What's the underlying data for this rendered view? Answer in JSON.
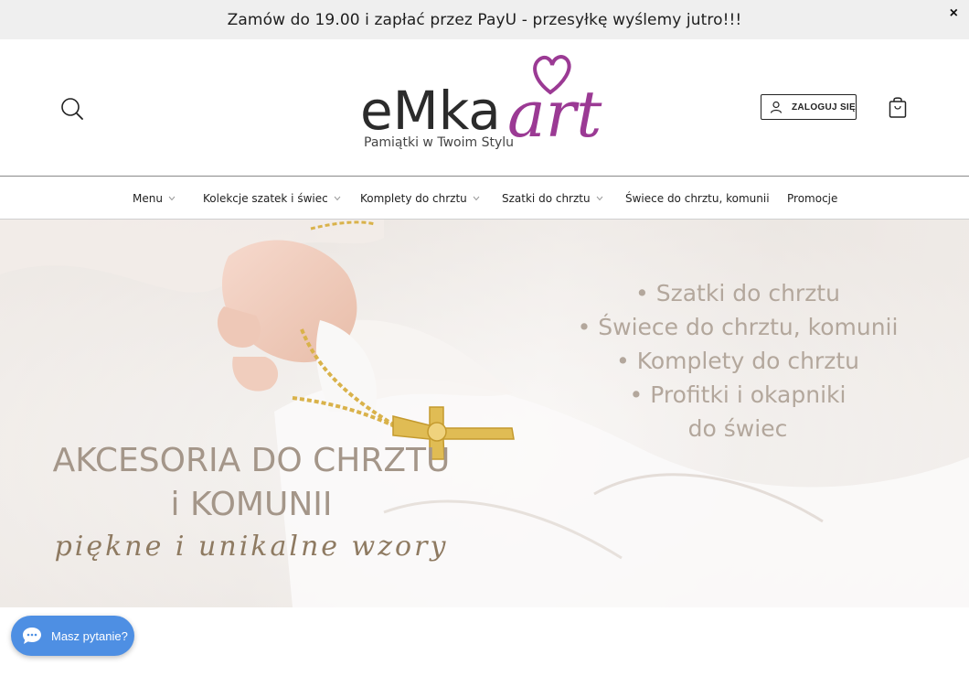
{
  "announcement": {
    "text": "Zamów do 19.00 i zapłać przez PayU - przesyłkę wyślemy jutro!!!",
    "close": "×"
  },
  "header": {
    "logo": {
      "brand_part1": "eMka",
      "brand_part2": "art",
      "tagline": "Pamiątki w Twoim Stylu",
      "colors": {
        "dark": "#2b2b2b",
        "accent": "#9b3a94"
      }
    },
    "login_label": "ZALOGUJ SIĘ",
    "icons": [
      "search-icon",
      "user-icon",
      "shopping-bag-icon"
    ]
  },
  "nav": {
    "items": [
      {
        "label": "Menu",
        "has_dropdown": true
      },
      {
        "label": "Kolekcje szatek i świec",
        "has_dropdown": true
      },
      {
        "label": "Komplety do chrztu",
        "has_dropdown": true
      },
      {
        "label": "Szatki do chrztu",
        "has_dropdown": true
      },
      {
        "label": "Świece do chrztu, komunii",
        "has_dropdown": false
      },
      {
        "label": "Promocje",
        "has_dropdown": false
      }
    ]
  },
  "hero": {
    "list": [
      "• Szatki do chrztu",
      "• Świece do chrztu, komunii",
      "• Komplety do chrztu",
      "• Profitki i okapniki",
      "do świec"
    ],
    "title_line1": "AKCESORIA DO CHRZTU",
    "title_line2": "i KOMUNII",
    "script": "piękne i unikalne wzory"
  },
  "chat": {
    "label": "Masz pytanie?",
    "color": "#4e8fe3"
  }
}
